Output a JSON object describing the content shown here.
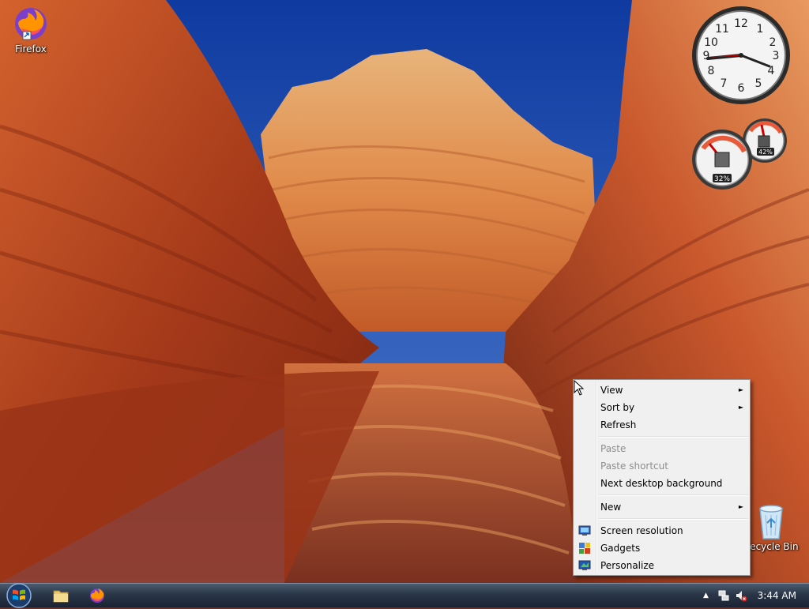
{
  "desktop": {
    "icons": [
      {
        "label": "Firefox"
      },
      {
        "label": "Recycle Bin"
      }
    ]
  },
  "gadgets": {
    "clock": {
      "time_shown": "8:46"
    },
    "cpu_meter": {
      "cpu_label": "32%",
      "cpu_value": 32,
      "memory_label": "42%",
      "memory_value": 42
    }
  },
  "context_menu": {
    "items": [
      {
        "label": "View",
        "submenu": true,
        "enabled": true
      },
      {
        "label": "Sort by",
        "submenu": true,
        "enabled": true
      },
      {
        "label": "Refresh",
        "enabled": true
      },
      {
        "label": "Paste",
        "enabled": false
      },
      {
        "label": "Paste shortcut",
        "enabled": false
      },
      {
        "label": "Next desktop background",
        "enabled": true
      },
      {
        "label": "New",
        "submenu": true,
        "enabled": true
      },
      {
        "label": "Screen resolution",
        "icon": "monitor-icon",
        "enabled": true
      },
      {
        "label": "Gadgets",
        "icon": "gadgets-icon",
        "enabled": true
      },
      {
        "label": "Personalize",
        "icon": "personalize-icon",
        "enabled": true
      }
    ],
    "submenu_arrow": "►"
  },
  "taskbar": {
    "pinned": [
      "folder-icon",
      "firefox-icon"
    ],
    "clock": "3:44 AM"
  },
  "colors": {
    "sky": "#1f4fb0",
    "rock": "#c8502a",
    "taskbar": "#2a3648",
    "menu_bg": "#f0f0f0"
  }
}
